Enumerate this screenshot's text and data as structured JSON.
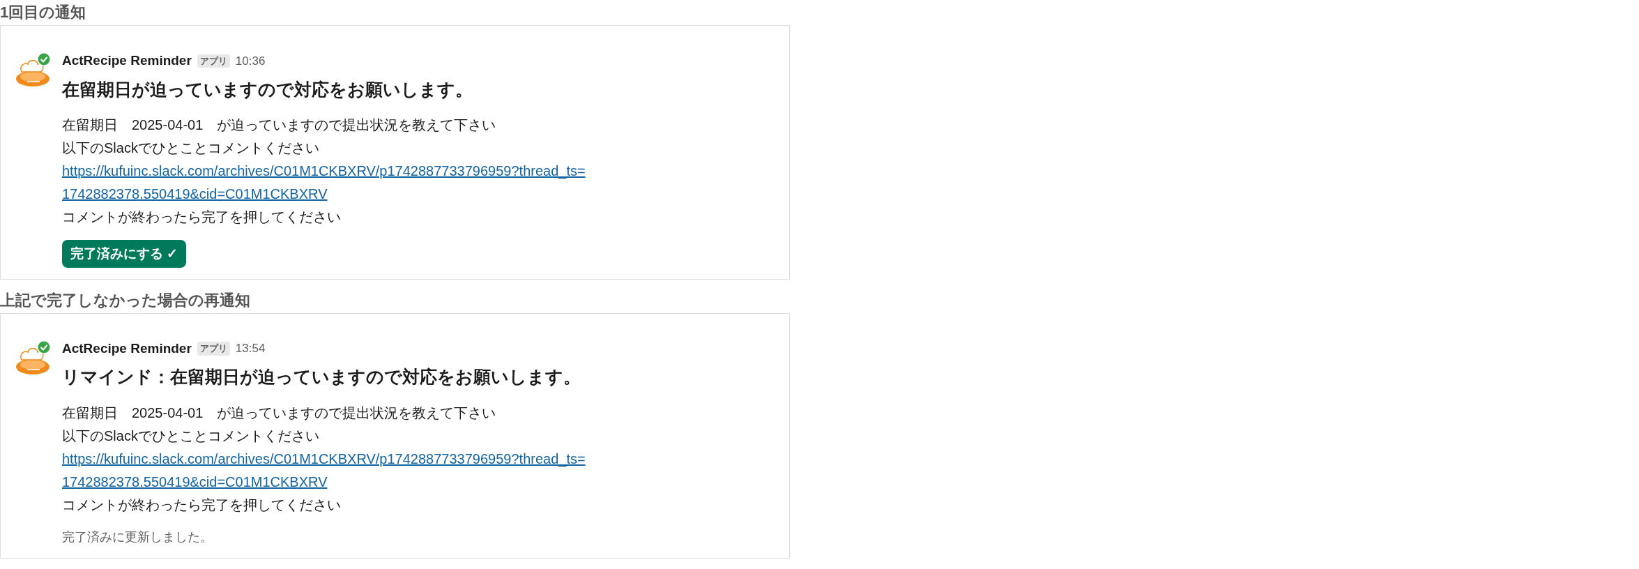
{
  "sections": [
    {
      "heading": "1回目の通知",
      "message": {
        "sender": "ActRecipe Reminder",
        "badge": "アプリ",
        "time": "10:36",
        "title": "在留期日が迫っていますので対応をお願いします。",
        "lines": [
          {
            "kind": "text",
            "text": "在留期日　2025-04-01　が迫っていますので提出状況を教えて下さい"
          },
          {
            "kind": "text",
            "text": "以下のSlackでひとことコメントください"
          },
          {
            "kind": "link",
            "text": "https://kufuinc.slack.com/archives/C01M1CKBXRV/p1742887733796959?thread_ts=1742882378.550419&cid=C01M1CKBXRV"
          },
          {
            "kind": "text",
            "text": "コメントが終わったら完了を押してください"
          }
        ],
        "footer": {
          "kind": "button",
          "text": "完了済みにする ✓"
        }
      }
    },
    {
      "heading": "上記で完了しなかった場合の再通知",
      "message": {
        "sender": "ActRecipe Reminder",
        "badge": "アプリ",
        "time": "13:54",
        "title": "リマインド：在留期日が迫っていますので対応をお願いします。",
        "lines": [
          {
            "kind": "text",
            "text": "在留期日　2025-04-01　が迫っていますので提出状況を教えて下さい"
          },
          {
            "kind": "text",
            "text": "以下のSlackでひとことコメントください"
          },
          {
            "kind": "link",
            "text": "https://kufuinc.slack.com/archives/C01M1CKBXRV/p1742887733796959?thread_ts=1742882378.550419&cid=C01M1CKBXRV"
          },
          {
            "kind": "text",
            "text": "コメントが終わったら完了を押してください"
          }
        ],
        "footer": {
          "kind": "status",
          "text": "完了済みに更新しました。"
        }
      }
    }
  ]
}
